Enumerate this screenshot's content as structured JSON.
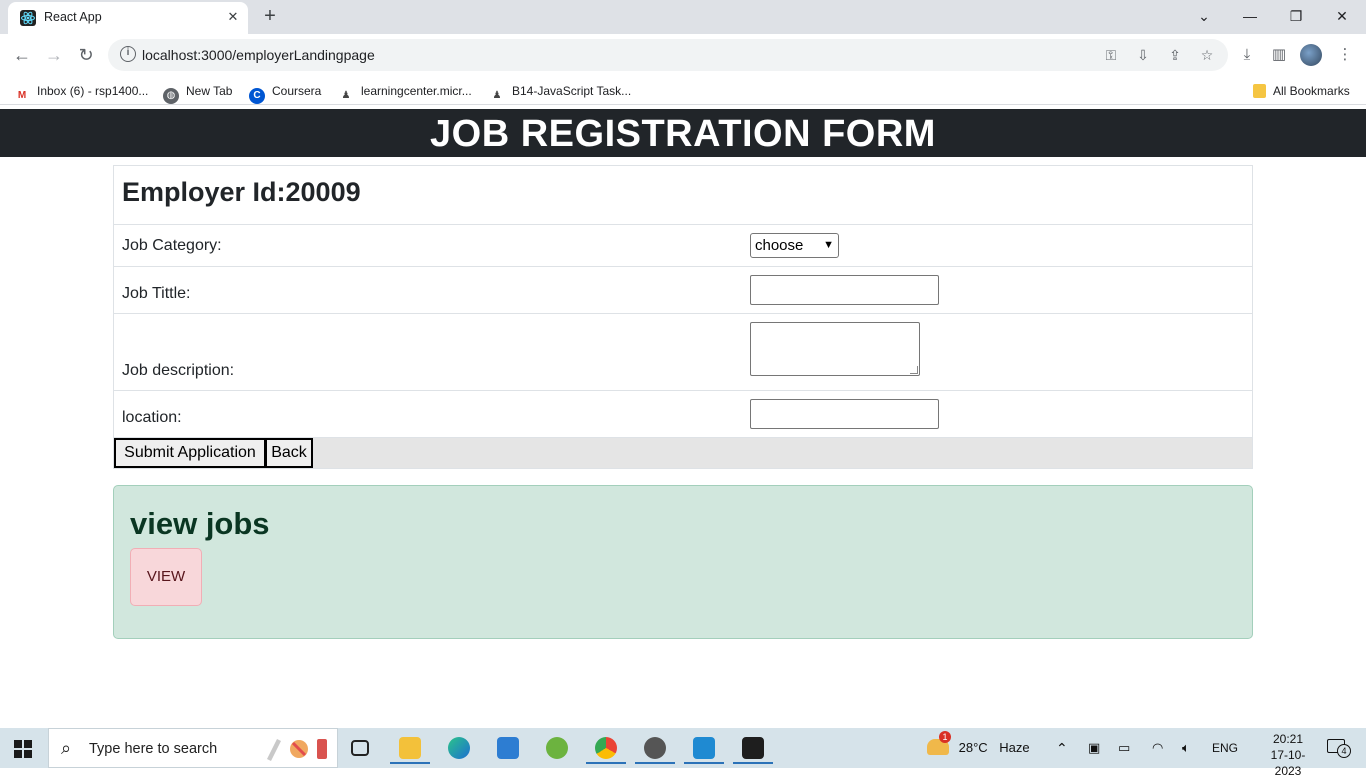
{
  "browser": {
    "tab_title": "React App",
    "tab_close": "✕",
    "new_tab": "+",
    "window_controls": [
      "⌄",
      "—",
      "❐",
      "✕"
    ],
    "url": "localhost:3000/employerLandingpage",
    "bookmarks": [
      {
        "label": "Inbox (6) - rsp1400...",
        "icon": "gmail-icon",
        "color": "#d93025"
      },
      {
        "label": "New Tab",
        "icon": "globe-icon",
        "color": "#5f6368"
      },
      {
        "label": "Coursera",
        "icon": "coursera-icon",
        "color": "#0056d2"
      },
      {
        "label": "learningcenter.micr...",
        "icon": "person-icon",
        "color": "#444444"
      },
      {
        "label": "B14-JavaScript Task...",
        "icon": "person-icon",
        "color": "#444444"
      }
    ],
    "all_bookmarks": "All Bookmarks"
  },
  "page": {
    "header": "JOB REGISTRATION FORM",
    "employer_id": "Employer Id:20009",
    "fields": {
      "category_label": "Job Category:",
      "category_value": "choose",
      "title_label": "Job Tittle:",
      "description_label": "Job description:",
      "location_label": "location:"
    },
    "buttons": {
      "submit": "Submit Application",
      "back": "Back"
    },
    "view_card": {
      "title": "view jobs",
      "button": "VIEW"
    }
  },
  "taskbar": {
    "search_placeholder": "Type here to search",
    "weather_temp": "28°C",
    "weather_desc": "Haze",
    "weather_badge": "1",
    "language": "ENG",
    "time": "20:21",
    "date": "17-10-2023",
    "notifications": "4"
  }
}
